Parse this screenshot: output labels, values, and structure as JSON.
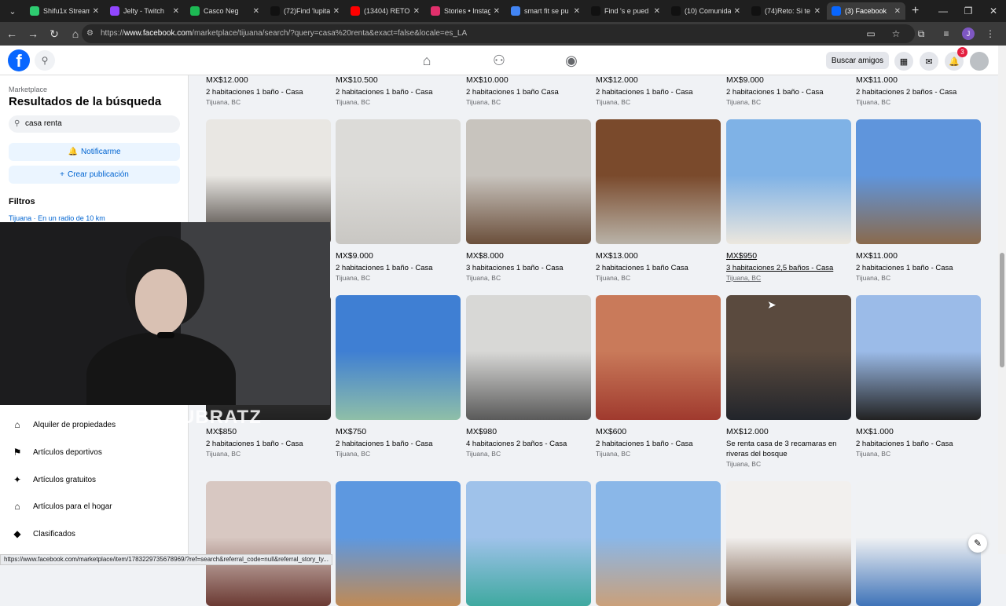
{
  "browser": {
    "tabs": [
      {
        "title": "Shifu1x Stream",
        "color": "#2ecc71"
      },
      {
        "title": "Jelty - Twitch",
        "color": "#9146ff"
      },
      {
        "title": "Casco Neg",
        "color": "#1db954"
      },
      {
        "title": "(72)Find 'lupita'",
        "color": "#111111"
      },
      {
        "title": "(13404) RETO",
        "color": "#ff0000"
      },
      {
        "title": "Stories • Instag",
        "color": "#e1306c"
      },
      {
        "title": "smart fit se pu",
        "color": "#4285f4"
      },
      {
        "title": "Find 's e pued",
        "color": "#111111"
      },
      {
        "title": "(10) Comunida",
        "color": "#111111"
      },
      {
        "title": "(74)Reto: Si te",
        "color": "#111111"
      },
      {
        "title": "(3) Facebook",
        "color": "#0866ff"
      }
    ],
    "url_prefix": "https://",
    "url_host": "www.facebook.com",
    "url_path": "/marketplace/tijuana/search/?query=casa%20renta&exact=false&locale=es_LA",
    "status_url": "https://www.facebook.com/marketplace/item/1783229735678969/?ref=search&referral_code=null&referral_story_ty..."
  },
  "fb": {
    "notification_count": "3",
    "friends_button": "Buscar amigos"
  },
  "sidebar": {
    "section": "Marketplace",
    "title": "Resultados de la búsqueda",
    "search_value": "casa renta",
    "notify_label": "Notificarme",
    "create_label": "Crear publicación",
    "filters_label": "Filtros",
    "location": "Tijuana · En un radio de 10 km",
    "categories": [
      {
        "label": "Alquiler de propiedades",
        "icon": "home-key-icon"
      },
      {
        "label": "Artículos deportivos",
        "icon": "running-icon"
      },
      {
        "label": "Artículos gratuitos",
        "icon": "gift-icon"
      },
      {
        "label": "Artículos para el hogar",
        "icon": "house-icon"
      },
      {
        "label": "Clasificados",
        "icon": "tag-icon"
      }
    ]
  },
  "stream_overlay_text": "UBRATZ",
  "listings": {
    "row0": [
      {
        "price": "MX$12.000",
        "desc": "2 habitaciones 1 baño - Casa",
        "loc": "Tijuana, BC"
      },
      {
        "price": "MX$10.500",
        "desc": "2 habitaciones 1 baño - Casa",
        "loc": "Tijuana, BC"
      },
      {
        "price": "MX$10.000",
        "desc": "2 habitaciones 1 baño Casa",
        "loc": "Tijuana, BC"
      },
      {
        "price": "MX$12.000",
        "desc": "2 habitaciones 1 baño - Casa",
        "loc": "Tijuana, BC"
      },
      {
        "price": "MX$9.000",
        "desc": "2 habitaciones 1 baño - Casa",
        "loc": "Tijuana, BC"
      },
      {
        "price": "MX$11.000",
        "desc": "2 habitaciones 2 baños - Casa",
        "loc": "Tijuana, BC"
      }
    ],
    "row1": [
      {
        "price": "",
        "desc": "",
        "loc": "",
        "img": [
          "#e9e7e3",
          "#3a332e"
        ]
      },
      {
        "price": "MX$9.000",
        "desc": "2 habitaciones 1 baño - Casa",
        "loc": "Tijuana, BC",
        "img": [
          "#dcdbd8",
          "#c9c7c3"
        ]
      },
      {
        "price": "MX$8.000",
        "desc": "3 habitaciones 1 baño - Casa",
        "loc": "Tijuana, BC",
        "img": [
          "#c8c4be",
          "#6b4f3b"
        ]
      },
      {
        "price": "MX$13.000",
        "desc": "2 habitaciones 1 baño Casa",
        "loc": "Tijuana, BC",
        "img": [
          "#7a4a2c",
          "#b9b3a8"
        ]
      },
      {
        "price": "MX$950",
        "desc": "3 habitaciones 2,5 baños - Casa",
        "loc": "Tijuana, BC",
        "img": [
          "#7fb2e6",
          "#ece7de"
        ]
      },
      {
        "price": "MX$11.000",
        "desc": "2 habitaciones 1 baño - Casa",
        "loc": "Tijuana, BC",
        "img": [
          "#5f95dc",
          "#8a6a4c"
        ]
      }
    ],
    "row2": [
      {
        "price": "MX$850",
        "desc": "2 habitaciones 1 baño - Casa",
        "loc": "Tijuana, BC",
        "img": [
          "#444",
          "#222"
        ]
      },
      {
        "price": "MX$750",
        "desc": "2 habitaciones 1 baño - Casa",
        "loc": "Tijuana, BC",
        "img": [
          "#3f7fd3",
          "#8fbfa8"
        ]
      },
      {
        "price": "MX$980",
        "desc": "4 habitaciones 2 baños - Casa",
        "loc": "Tijuana, BC",
        "img": [
          "#d8d8d6",
          "#5a5a5a"
        ]
      },
      {
        "price": "MX$600",
        "desc": "2 habitaciones 1 baño - Casa",
        "loc": "Tijuana, BC",
        "img": [
          "#c97a5a",
          "#a03a2e"
        ]
      },
      {
        "price": "MX$12.000",
        "desc": "Se renta casa de 3 recamaras en riveras del bosque",
        "loc": "Tijuana, BC",
        "img": [
          "#5a4a3e",
          "#22252b"
        ]
      },
      {
        "price": "MX$1.000",
        "desc": "2 habitaciones 1 baño - Casa",
        "loc": "Tijuana, BC",
        "img": [
          "#9bbbe8",
          "#222"
        ]
      }
    ],
    "row3": [
      {
        "img": [
          "#d8c8c2",
          "#6b3a33"
        ]
      },
      {
        "img": [
          "#5d98e0",
          "#c08a55"
        ]
      },
      {
        "img": [
          "#9fc2ea",
          "#3fa9a0"
        ]
      },
      {
        "img": [
          "#8ab7e8",
          "#caa07a"
        ]
      },
      {
        "img": [
          "#f2f0ee",
          "#6b4a35"
        ]
      },
      {
        "img": [
          "#f0f2f4",
          "#3f73b8"
        ]
      }
    ]
  }
}
